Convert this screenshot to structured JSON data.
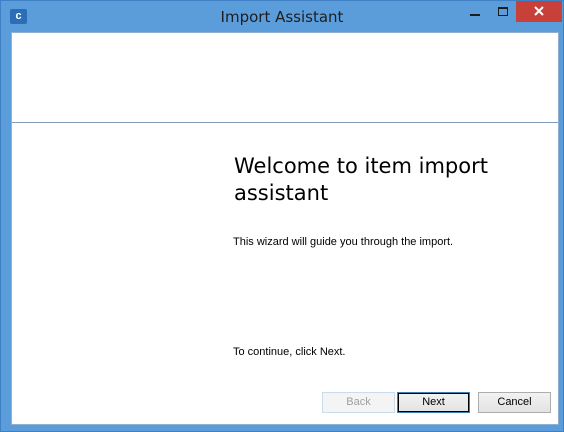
{
  "window": {
    "title": "Import Assistant",
    "app_icon_glyph": "c",
    "app_icon": "app-icon",
    "controls": [
      "minimize-icon",
      "maximize-icon",
      "close-icon"
    ],
    "close_color": "#c7413a",
    "frame_color": "#5b9ddb"
  },
  "wizard": {
    "heading": "Welcome to item import assistant",
    "description": "This wizard will guide you through the import.",
    "continue_hint": "To continue, click Next."
  },
  "buttons": {
    "back": "Back",
    "next": "Next",
    "cancel": "Cancel"
  }
}
